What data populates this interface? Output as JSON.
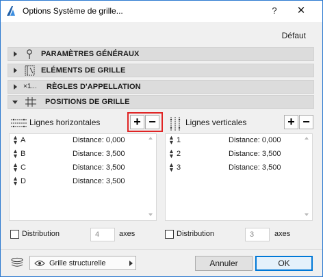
{
  "window": {
    "title": "Options Système de grille...",
    "help_label": "?",
    "close_label": "✕"
  },
  "default_label": "Défaut",
  "sections": [
    {
      "label": "PARAMÈTRES GÉNÉRAUX",
      "icon": "pin-icon",
      "expanded": false
    },
    {
      "label": "ELÉMENTS DE GRILLE",
      "icon": "grid-element-icon",
      "expanded": false
    },
    {
      "label": "RÈGLES D'APPELLATION",
      "icon": "naming-icon",
      "icon_text": "×1...",
      "expanded": false
    },
    {
      "label": "POSITIONS DE GRILLE",
      "icon": "grid-positions-icon",
      "expanded": true
    }
  ],
  "horizontal": {
    "heading": "Lignes horizontales",
    "plus": "+",
    "minus": "−",
    "rows": [
      {
        "name": "A",
        "distance": "Distance: 0,000"
      },
      {
        "name": "B",
        "distance": "Distance: 3,500"
      },
      {
        "name": "C",
        "distance": "Distance: 3,500"
      },
      {
        "name": "D",
        "distance": "Distance: 3,500"
      }
    ],
    "distribution_label": "Distribution",
    "distribution_count": "4",
    "axes_label": "axes"
  },
  "vertical": {
    "heading": "Lignes verticales",
    "plus": "+",
    "minus": "−",
    "rows": [
      {
        "name": "1",
        "distance": "Distance: 0,000"
      },
      {
        "name": "2",
        "distance": "Distance: 3,500"
      },
      {
        "name": "3",
        "distance": "Distance: 3,500"
      }
    ],
    "distribution_label": "Distribution",
    "distribution_count": "3",
    "axes_label": "axes"
  },
  "footer": {
    "layer_dropdown": "Grille structurelle",
    "cancel_label": "Annuler",
    "ok_label": "OK"
  },
  "colors": {
    "highlight_frame": "#e02424",
    "window_border": "#2b79d0",
    "ok_border": "#0078d7"
  }
}
